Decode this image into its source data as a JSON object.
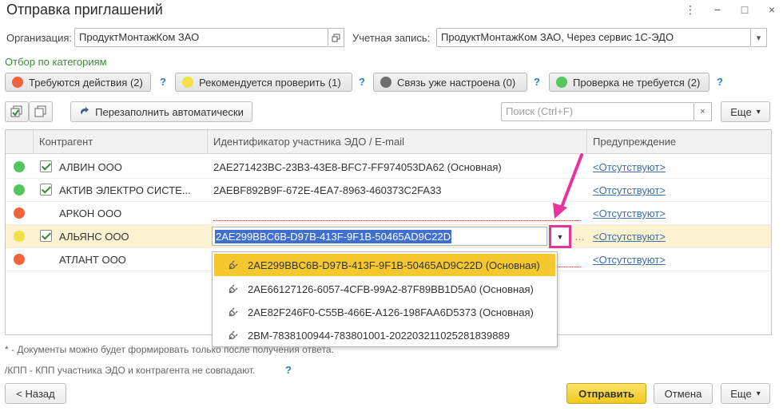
{
  "window": {
    "title": "Отправка приглашений",
    "more_glyph": "⋮",
    "minimize_glyph": "−",
    "maximize_glyph": "□",
    "close_glyph": "×"
  },
  "form": {
    "org_label": "Организация:",
    "org_value": "ПродуктМонтажКом ЗАО",
    "account_label": "Учетная запись:",
    "account_value": "ПродуктМонтажКом ЗАО, Через сервис 1С-ЭДО"
  },
  "filter": {
    "title": "Отбор по категориям",
    "categories": [
      {
        "label": "Требуются действия (2)",
        "color": "#f0643c"
      },
      {
        "label": "Рекомендуется проверить (1)",
        "color": "#f4e04a"
      },
      {
        "label": "Связь уже настроена (0)",
        "color": "#6f6f6f"
      },
      {
        "label": "Проверка не требуется (2)",
        "color": "#55c65c"
      }
    ],
    "help_glyph": "?"
  },
  "toolbar": {
    "refill_label": "Перезаполнить автоматически",
    "search_placeholder": "Поиск (Ctrl+F)",
    "clear_glyph": "×",
    "more_label": "Еще"
  },
  "table": {
    "headers": {
      "contractor": "Контрагент",
      "identifier": "Идентификатор участника ЭДО / E-mail",
      "warning": "Предупреждение"
    },
    "rows": [
      {
        "status_color": "#55c65c",
        "checked": true,
        "contractor": "АЛВИН ООО",
        "identifier": "2AE271423BC-23B3-43E8-BFC7-FF974053DA62 (Основная)",
        "warning": "<Отсутствуют>"
      },
      {
        "status_color": "#55c65c",
        "checked": true,
        "contractor": "АКТИВ ЭЛЕКТРО СИСТЕ...",
        "identifier": "2AEBF892B9F-672E-4EA7-8963-460373C2FA33",
        "warning": "<Отсутствуют>"
      },
      {
        "status_color": "#f0643c",
        "checked": false,
        "contractor": "АРКОН ООО",
        "identifier": "",
        "warning": "<Отсутствуют>"
      },
      {
        "status_color": "#f4e04a",
        "checked": true,
        "contractor": "АЛЬЯНС ООО",
        "identifier": "2AE299BBC6B-D97B-413F-9F1B-50465AD9C22D",
        "warning": "<Отсутствуют>"
      },
      {
        "status_color": "#f0643c",
        "checked": false,
        "contractor": "АТЛАНТ ООО",
        "identifier": "",
        "warning": "<Отсутствуют>"
      }
    ]
  },
  "dropdown": {
    "items": [
      "2AE299BBC6B-D97B-413F-9F1B-50465AD9C22D (Основная)",
      "2AE66127126-6057-4CFB-99A2-87F89BB1D5A0 (Основная)",
      "2AE82F246F0-C55B-466E-A126-198FAA6D5373 (Основная)",
      "2BM-7838100944-783801001-20220321102528183​9889"
    ]
  },
  "footnotes": {
    "line1": "* - Документы можно будет формировать только после получения ответа.",
    "line2": "/КПП - КПП участника ЭДО и контрагента не совпадают."
  },
  "footer": {
    "back_label": "< Назад",
    "send_label": "Отправить",
    "cancel_label": "Отмена",
    "more_label": "Еще"
  },
  "annotation": {
    "arrow_color": "#e8339a"
  }
}
